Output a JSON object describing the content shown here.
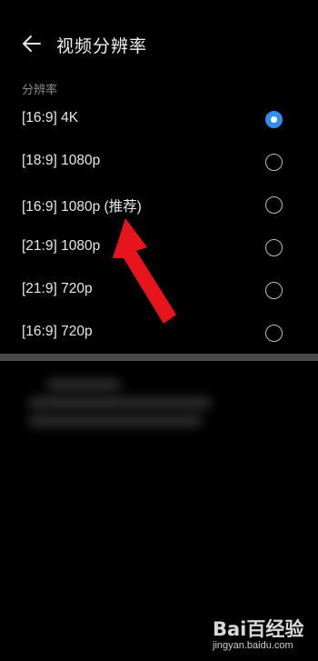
{
  "header": {
    "title": "视频分辨率"
  },
  "section": {
    "label": "分辨率"
  },
  "options": [
    {
      "label": "[16:9] 4K",
      "selected": true
    },
    {
      "label": "[18:9] 1080p",
      "selected": false
    },
    {
      "label": "[16:9] 1080p (推荐)",
      "selected": false
    },
    {
      "label": "[21:9] 1080p",
      "selected": false
    },
    {
      "label": "[21:9] 720p",
      "selected": false
    },
    {
      "label": "[16:9] 720p",
      "selected": false
    }
  ],
  "watermark": {
    "brand": "Bai百经验",
    "url": "jingyan.baidu.com"
  },
  "colors": {
    "accent": "#2e8ff0",
    "annotation": "#e8141c",
    "background": "#000000"
  }
}
